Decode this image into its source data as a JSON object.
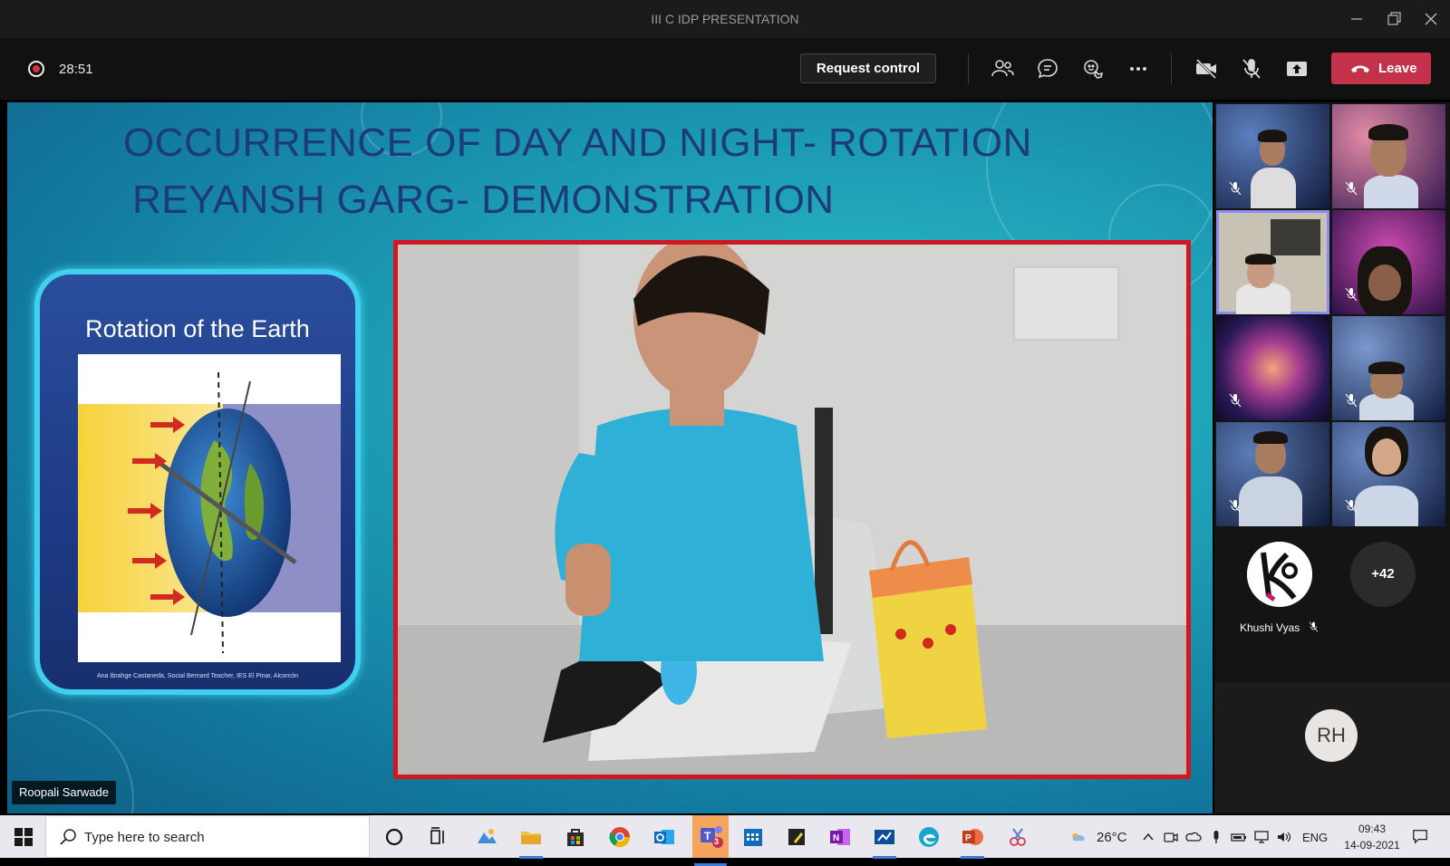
{
  "window": {
    "title": "III C IDP PRESENTATION"
  },
  "meeting": {
    "timer": "28:51",
    "request_control_label": "Request control",
    "leave_label": "Leave"
  },
  "slide": {
    "title_line1": "OCCURRENCE OF DAY AND NIGHT- ROTATION",
    "title_line2": "REYANSH GARG- DEMONSTRATION",
    "card_title": "Rotation of the Earth",
    "card_credit": "Ana Ibrahge Castaneda, Social Bernard Teacher, IES El Pinar, Alcorcón"
  },
  "presenter": {
    "name": "Roopali Sarwade"
  },
  "participants": {
    "named_participant": "Khushi Vyas",
    "named_initials": "K",
    "overflow_count": "+42",
    "initials_avatar": "RH"
  },
  "taskbar": {
    "search_placeholder": "Type here to search",
    "weather": "26°C",
    "language": "ENG",
    "time": "09:43",
    "date": "14-09-2021",
    "teams_badge": "3"
  },
  "colors": {
    "leave": "#c4314b",
    "active_tile": "#8a8cf0",
    "video_border": "#d11820",
    "slide_title": "#1c3b7a",
    "card_glow": "#3fd0f0"
  }
}
